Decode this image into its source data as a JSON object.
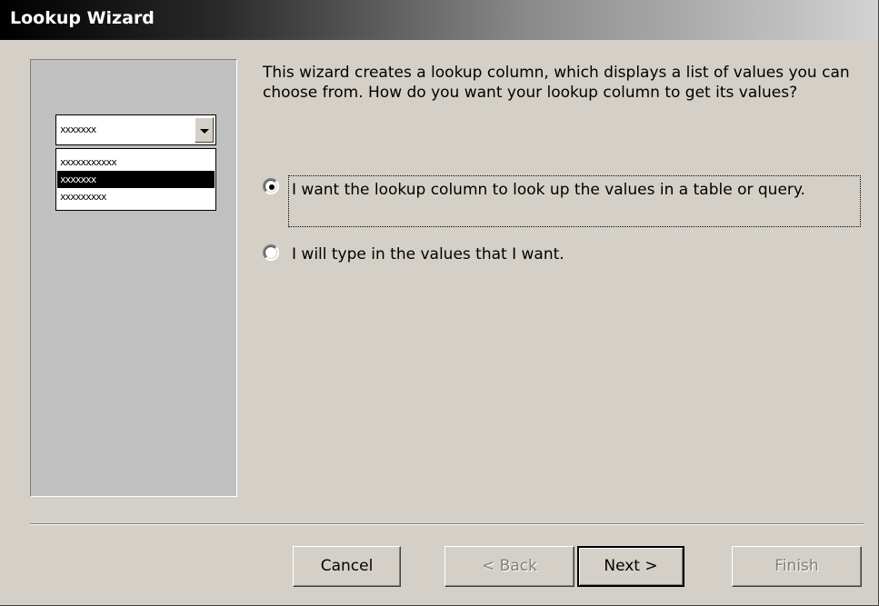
{
  "window": {
    "title": "Lookup Wizard"
  },
  "illustration": {
    "combo_value": "xxxxxxx",
    "list_items": [
      "xxxxxxxxxxx",
      "xxxxxxx",
      "xxxxxxxxx"
    ],
    "selected_index": 1
  },
  "intro_text": "This wizard creates a lookup column, which displays a list of values you can choose from.  How do you want your lookup column to get its values?",
  "options": [
    {
      "label": "I want the lookup column to look up the values in a table or query.",
      "checked": true
    },
    {
      "label": "I will type in the values that I want.",
      "checked": false
    }
  ],
  "buttons": {
    "cancel": "Cancel",
    "back": "< Back",
    "next": "Next >",
    "finish": "Finish"
  }
}
